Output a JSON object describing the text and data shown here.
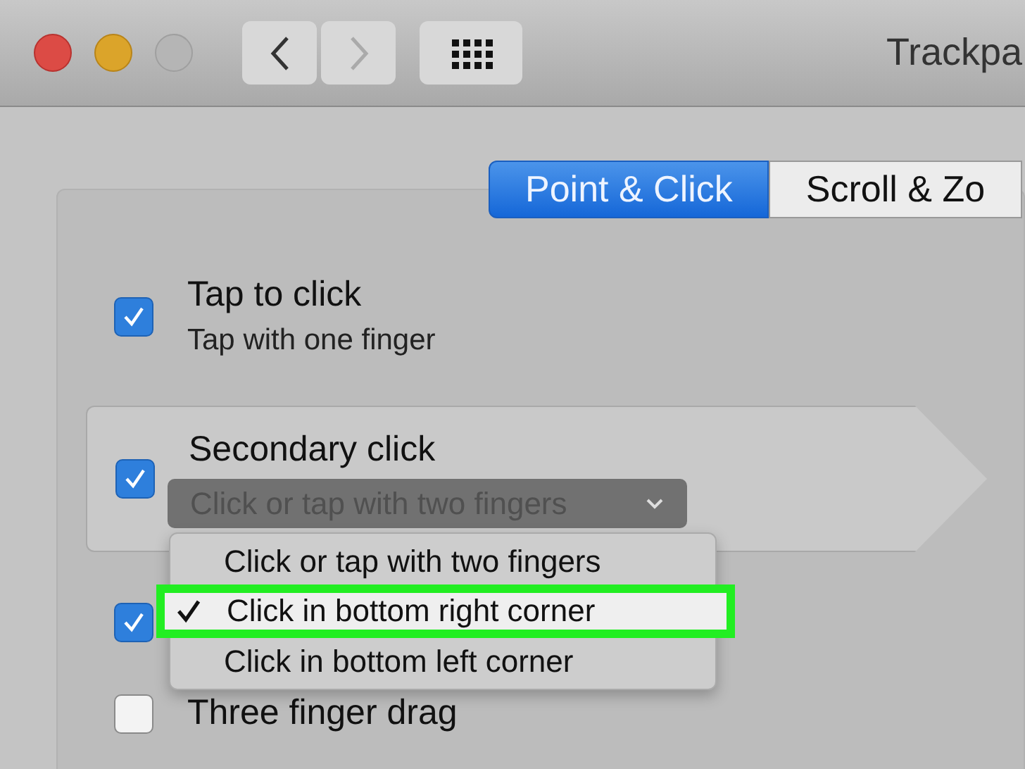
{
  "window": {
    "title": "Trackpa"
  },
  "toolbar": {
    "back_disabled": false,
    "forward_disabled": true
  },
  "tabs": [
    {
      "label": "Point & Click",
      "selected": true
    },
    {
      "label": "Scroll & Zo",
      "selected": false
    }
  ],
  "settings": [
    {
      "label": "Tap to click",
      "subtitle": "Tap with one finger",
      "checked": true,
      "highlighted": false
    },
    {
      "label": "Secondary click",
      "dropdown": "Click or tap with two fingers",
      "checked": true,
      "highlighted": true
    },
    {
      "checked": true,
      "highlighted": false
    },
    {
      "label": "Three finger drag",
      "checked": false,
      "highlighted": false
    }
  ],
  "menu": [
    {
      "label": "Click or tap with two fingers",
      "selected": false
    },
    {
      "label": "Click in bottom right corner",
      "selected": true
    },
    {
      "label": "Click in bottom left corner",
      "selected": false
    }
  ]
}
